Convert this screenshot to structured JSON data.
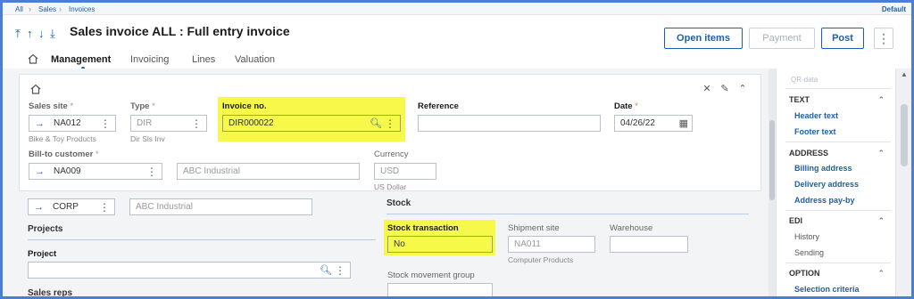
{
  "breadcrumb": [
    "All",
    "Sales",
    "Invoices"
  ],
  "profile": "Default",
  "title": "Sales invoice ALL : Full entry invoice",
  "actions": {
    "open_items": "Open items",
    "payment": "Payment",
    "post": "Post",
    "more": "⋮"
  },
  "tabs": [
    "Management",
    "Invoicing",
    "Lines",
    "Valuation"
  ],
  "form": {
    "sales_site": {
      "label": "Sales site",
      "value": "NA012",
      "sub": "Bike & Toy Products"
    },
    "type": {
      "label": "Type",
      "value": "DIR",
      "sub": "Dir Sls Inv"
    },
    "invoice_no": {
      "label": "Invoice no.",
      "value": "DIR000022"
    },
    "reference": {
      "label": "Reference",
      "value": ""
    },
    "date": {
      "label": "Date",
      "value": "04/26/22"
    },
    "bill_to": {
      "label": "Bill-to customer",
      "value": "NA009",
      "name": "ABC Industrial"
    },
    "currency": {
      "label": "Currency",
      "value": "USD",
      "sub": "US Dollar"
    },
    "corp": {
      "value": "CORP",
      "name": "ABC Industrial"
    }
  },
  "stock": {
    "title": "Stock",
    "transaction": {
      "label": "Stock transaction",
      "value": "No"
    },
    "shipment_site": {
      "label": "Shipment site",
      "value": "NA011",
      "sub": "Computer Products"
    },
    "warehouse": {
      "label": "Warehouse",
      "value": ""
    },
    "movement_group": {
      "label": "Stock movement group"
    }
  },
  "projects": {
    "title": "Projects",
    "project_label": "Project"
  },
  "sales_reps": "Sales reps",
  "right_panel": {
    "top": "QR-data",
    "sections": [
      {
        "title": "TEXT",
        "links": [
          "Header text",
          "Footer text"
        ]
      },
      {
        "title": "ADDRESS",
        "links": [
          "Billing address",
          "Delivery address",
          "Address pay-by"
        ]
      },
      {
        "title": "EDI",
        "items": [
          "History",
          "Sending"
        ]
      },
      {
        "title": "OPTION",
        "links": [
          "Selection criteria"
        ]
      }
    ]
  },
  "colors": {
    "accent": "#1f5fa8",
    "highlight": "#f6f84a",
    "border": "#4a7fd4"
  }
}
